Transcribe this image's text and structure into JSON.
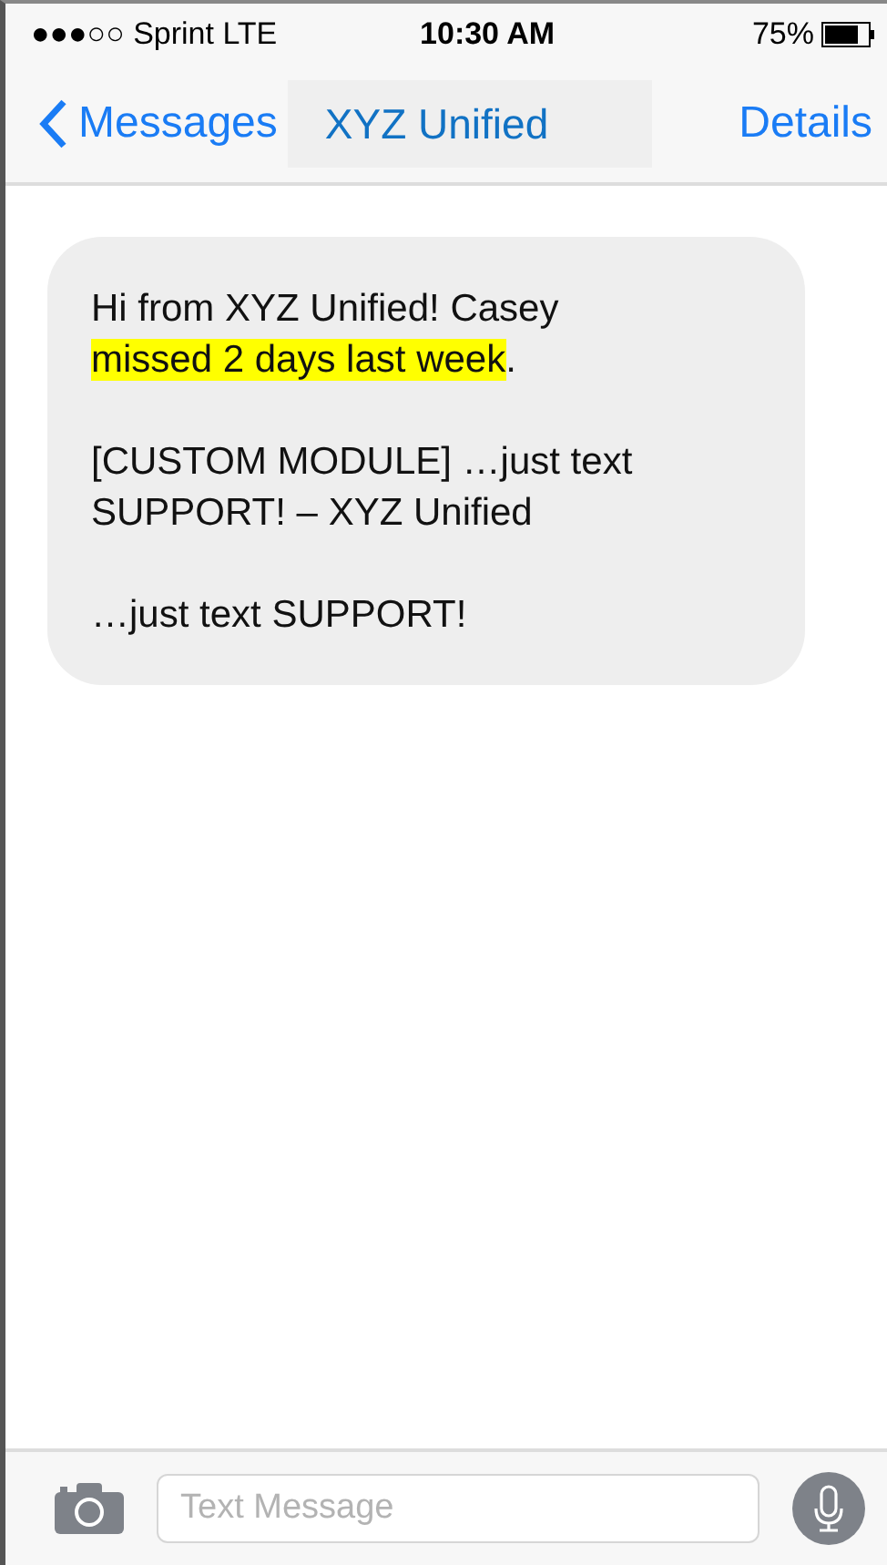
{
  "status_bar": {
    "carrier": "●●●○○ Sprint  LTE",
    "time": "10:30 AM",
    "battery": "75%"
  },
  "nav_bar": {
    "back": "Messages",
    "title": "XYZ Unified",
    "action": "Details"
  },
  "messages": [
    {
      "paragraphs": [
        [
          {
            "text": "Hi from XYZ Unified! Casey ",
            "highlighted": false
          },
          {
            "text": "missed 2 days last week",
            "highlighted": true
          },
          {
            "text": ".",
            "highlighted": false
          }
        ],
        [
          {
            "text": "[CUSTOM MODULE] …just text SUPPORT! – XYZ Unified",
            "highlighted": false
          }
        ],
        [
          {
            "text": "…just text SUPPORT!",
            "highlighted": false
          }
        ]
      ]
    }
  ],
  "composer": {
    "placeholder": "Text Message"
  }
}
